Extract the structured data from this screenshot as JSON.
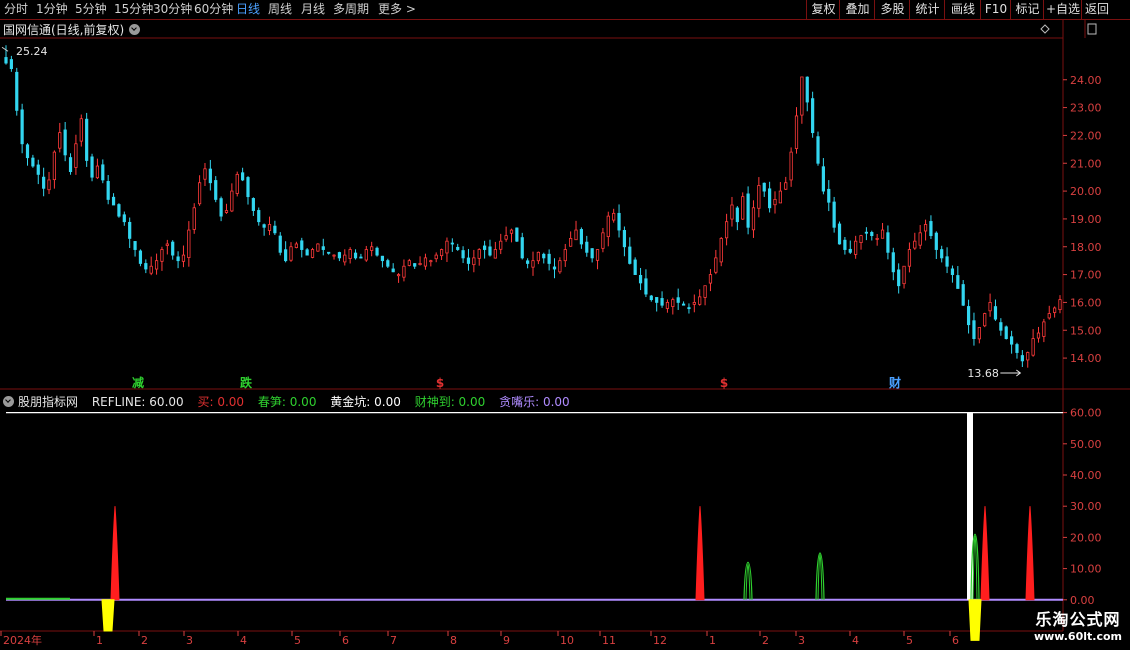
{
  "toolbar": {
    "periods": [
      "分时",
      "1分钟",
      "5分钟",
      "15分钟",
      "30分钟",
      "60分钟",
      "日线",
      "周线",
      "月线",
      "多周期",
      "更多 >"
    ],
    "active": "日线",
    "right": [
      "复权",
      "叠加",
      "多股",
      "统计",
      "画线",
      "F10",
      "标记",
      "+自选",
      "返回"
    ]
  },
  "main_title": "国网信通(日线,前复权)",
  "high_label": "25.24",
  "low_label": "13.68",
  "signals": [
    {
      "text": "减",
      "color": "#2fd02f"
    },
    {
      "text": "跌",
      "color": "#2fd02f"
    },
    {
      "text": "$",
      "color": "#e03030"
    },
    {
      "text": "$",
      "color": "#e03030"
    },
    {
      "text": "财",
      "color": "#4aa0ff"
    }
  ],
  "indicator": {
    "name": "股朋指标网",
    "items": [
      {
        "label": "REFLINE: 60.00",
        "color": "#e6e6e6"
      },
      {
        "label": "买: 0.00",
        "color": "#e03030"
      },
      {
        "label": "春笋: 0.00",
        "color": "#2fd02f"
      },
      {
        "label": "黄金坑: 0.00",
        "color": "#ffffff"
      },
      {
        "label": "财神到: 0.00",
        "color": "#2fd02f"
      },
      {
        "label": "贪嘴乐: 0.00",
        "color": "#b08cff"
      }
    ]
  },
  "price_axis": {
    "ticks": [
      "24.00",
      "23.00",
      "22.00",
      "21.00",
      "20.00",
      "19.00",
      "18.00",
      "17.00",
      "16.00",
      "15.00",
      "14.00"
    ]
  },
  "ind_axis": {
    "ticks": [
      "60.00",
      "50.00",
      "40.00",
      "30.00",
      "20.00",
      "10.00",
      "0.00"
    ]
  },
  "x_axis": {
    "labels": [
      "2024年",
      "1",
      "2",
      "3",
      "4",
      "5",
      "6",
      "7",
      "8",
      "9",
      "10",
      "11",
      "12",
      "1",
      "2",
      "3",
      "4",
      "5",
      "6"
    ]
  },
  "watermark": {
    "line1": "乐淘公式网",
    "line2": "www.60lt.com"
  },
  "chart_data": {
    "type": "candlestick",
    "symbol": "国网信通",
    "price_range": [
      13.5,
      25.5
    ],
    "high": 25.24,
    "low": 13.68,
    "closes": [
      24.6,
      24.4,
      22.9,
      21.7,
      21.2,
      20.9,
      20.6,
      20.1,
      20.4,
      21.4,
      22.1,
      21.3,
      20.7,
      21.7,
      22.6,
      21.1,
      20.5,
      20.9,
      20.4,
      19.7,
      19.5,
      19.1,
      18.9,
      18.3,
      17.9,
      17.4,
      17.2,
      17.3,
      17.5,
      17.9,
      18.1,
      17.7,
      17.5,
      17.7,
      18.6,
      19.4,
      20.3,
      20.8,
      20.3,
      19.7,
      19.1,
      19.3,
      20.0,
      20.6,
      20.4,
      19.8,
      19.3,
      18.9,
      18.7,
      18.8,
      18.5,
      17.8,
      17.5,
      18.0,
      18.1,
      17.9,
      17.7,
      17.9,
      18.1,
      17.9,
      17.8,
      17.7,
      17.6,
      17.7,
      17.9,
      17.6,
      17.6,
      17.9,
      18.0,
      17.7,
      17.5,
      17.3,
      17.1,
      17.0,
      17.3,
      17.5,
      17.3,
      17.4,
      17.6,
      17.5,
      17.7,
      17.9,
      18.2,
      18.1,
      17.9,
      17.6,
      17.4,
      17.6,
      17.9,
      17.9,
      17.7,
      17.9,
      18.2,
      18.4,
      18.6,
      18.2,
      17.6,
      17.4,
      17.5,
      17.8,
      17.6,
      17.4,
      17.2,
      17.5,
      17.9,
      18.3,
      18.6,
      18.1,
      17.8,
      17.6,
      17.9,
      18.5,
      19.1,
      19.2,
      18.6,
      18.0,
      17.4,
      17.0,
      16.7,
      16.3,
      16.1,
      16.0,
      15.9,
      16.0,
      16.1,
      16.0,
      15.9,
      15.8,
      16.0,
      16.2,
      16.6,
      17.0,
      17.6,
      18.3,
      18.9,
      19.5,
      18.9,
      19.8,
      18.7,
      19.4,
      20.2,
      20.0,
      19.4,
      19.7,
      20.0,
      20.3,
      21.4,
      22.7,
      24.1,
      23.2,
      22.1,
      21.0,
      20.0,
      19.6,
      18.7,
      18.1,
      17.9,
      17.8,
      18.2,
      18.4,
      18.5,
      18.4,
      18.3,
      18.6,
      17.8,
      17.1,
      16.6,
      17.3,
      17.9,
      18.2,
      18.5,
      18.8,
      18.4,
      17.9,
      17.6,
      17.3,
      17.0,
      16.5,
      15.9,
      15.2,
      14.7,
      15.1,
      15.6,
      16.0,
      15.4,
      15.0,
      14.7,
      14.5,
      14.2,
      13.9,
      14.2,
      14.7,
      14.9,
      15.3,
      15.6,
      15.8,
      16.1
    ]
  },
  "indicator_data": {
    "y_range": [
      -10,
      65
    ],
    "refline": 60,
    "buy_peaks": [
      {
        "x": 115,
        "v": 30
      },
      {
        "x": 700,
        "v": 30
      },
      {
        "x": 985,
        "v": 30
      },
      {
        "x": 1030,
        "v": 30
      }
    ],
    "green_peaks": [
      {
        "x": 748,
        "v": 12
      },
      {
        "x": 820,
        "v": 15
      },
      {
        "x": 975,
        "v": 21
      }
    ],
    "yellow_dips": [
      {
        "x": 108,
        "v": -10
      },
      {
        "x": 975,
        "v": -13
      }
    ],
    "white_bar": {
      "x": 970,
      "v": 60
    }
  }
}
